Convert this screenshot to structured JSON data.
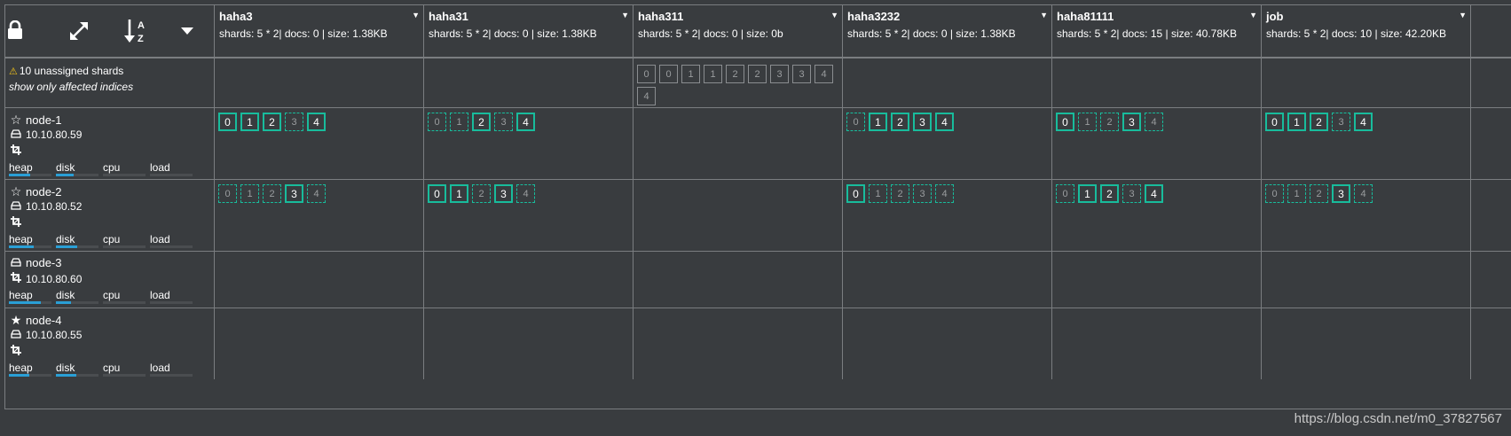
{
  "header": {
    "controls": [
      {
        "name": "lock-icon",
        "glyph": "lock"
      },
      {
        "name": "expand-icon",
        "glyph": "expand"
      },
      {
        "name": "sort-alpha-icon",
        "glyph": "sort"
      },
      {
        "name": "caret-down-icon",
        "glyph": "caret"
      }
    ]
  },
  "indices": [
    {
      "name": "haha3",
      "stats": "shards: 5 * 2| docs: 0 | size: 1.38KB"
    },
    {
      "name": "haha31",
      "stats": "shards: 5 * 2| docs: 0 | size: 1.38KB"
    },
    {
      "name": "haha311",
      "stats": "shards: 5 * 2| docs: 0 | size: 0b"
    },
    {
      "name": "haha3232",
      "stats": "shards: 5 * 2| docs: 0 | size: 1.38KB"
    },
    {
      "name": "haha81111",
      "stats": "shards: 5 * 2| docs: 15 | size: 40.78KB"
    },
    {
      "name": "job",
      "stats": "shards: 5 * 2| docs: 10 | size: 42.20KB"
    }
  ],
  "unassigned": {
    "message": "10 unassigned shards",
    "link": "show only affected indices",
    "shards": [
      [],
      [],
      [
        "0",
        "0",
        "1",
        "1",
        "2",
        "2",
        "3",
        "3",
        "4",
        "4"
      ],
      [],
      [],
      []
    ]
  },
  "nodes": [
    {
      "name": "node-1",
      "ip": "10.10.80.59",
      "role_icon": "star-outline-icon",
      "master": false,
      "show_name_icon": true,
      "metrics": [
        {
          "label": "heap",
          "level": 0.5
        },
        {
          "label": "disk",
          "level": 0.42
        },
        {
          "label": "cpu",
          "level": 0
        },
        {
          "label": "load",
          "level": 0
        }
      ],
      "shards": [
        [
          [
            "0",
            "p"
          ],
          [
            "1",
            "p"
          ],
          [
            "2",
            "p"
          ],
          [
            "3",
            "r"
          ],
          [
            "4",
            "p"
          ]
        ],
        [
          [
            "0",
            "r"
          ],
          [
            "1",
            "r"
          ],
          [
            "2",
            "p"
          ],
          [
            "3",
            "r"
          ],
          [
            "4",
            "p"
          ]
        ],
        [],
        [
          [
            "0",
            "r"
          ],
          [
            "1",
            "p"
          ],
          [
            "2",
            "p"
          ],
          [
            "3",
            "p"
          ],
          [
            "4",
            "p"
          ]
        ],
        [
          [
            "0",
            "p"
          ],
          [
            "1",
            "r"
          ],
          [
            "2",
            "r"
          ],
          [
            "3",
            "p"
          ],
          [
            "4",
            "r"
          ]
        ],
        [
          [
            "0",
            "p"
          ],
          [
            "1",
            "p"
          ],
          [
            "2",
            "p"
          ],
          [
            "3",
            "r"
          ],
          [
            "4",
            "p"
          ]
        ]
      ]
    },
    {
      "name": "node-2",
      "ip": "10.10.80.52",
      "role_icon": "star-outline-icon",
      "master": false,
      "show_name_icon": true,
      "metrics": [
        {
          "label": "heap",
          "level": 0.58
        },
        {
          "label": "disk",
          "level": 0.5
        },
        {
          "label": "cpu",
          "level": 0
        },
        {
          "label": "load",
          "level": 0
        }
      ],
      "shards": [
        [
          [
            "0",
            "r"
          ],
          [
            "1",
            "r"
          ],
          [
            "2",
            "r"
          ],
          [
            "3",
            "p"
          ],
          [
            "4",
            "r"
          ]
        ],
        [
          [
            "0",
            "p"
          ],
          [
            "1",
            "p"
          ],
          [
            "2",
            "r"
          ],
          [
            "3",
            "p"
          ],
          [
            "4",
            "r"
          ]
        ],
        [],
        [
          [
            "0",
            "p"
          ],
          [
            "1",
            "r"
          ],
          [
            "2",
            "r"
          ],
          [
            "3",
            "r"
          ],
          [
            "4",
            "r"
          ]
        ],
        [
          [
            "0",
            "r"
          ],
          [
            "1",
            "p"
          ],
          [
            "2",
            "p"
          ],
          [
            "3",
            "r"
          ],
          [
            "4",
            "p"
          ]
        ],
        [
          [
            "0",
            "r"
          ],
          [
            "1",
            "r"
          ],
          [
            "2",
            "r"
          ],
          [
            "3",
            "p"
          ],
          [
            "4",
            "r"
          ]
        ]
      ]
    },
    {
      "name": "node-3",
      "ip": "10.10.80.60",
      "role_icon": "drive-icon",
      "master": false,
      "show_name_icon": false,
      "metrics": [
        {
          "label": "heap",
          "level": 0.75
        },
        {
          "label": "disk",
          "level": 0.35
        },
        {
          "label": "cpu",
          "level": 0
        },
        {
          "label": "load",
          "level": 0
        }
      ],
      "shards": [
        [],
        [],
        [],
        [],
        [],
        []
      ]
    },
    {
      "name": "node-4",
      "ip": "10.10.80.55",
      "role_icon": "star-solid-icon",
      "master": true,
      "show_name_icon": true,
      "metrics": [
        {
          "label": "heap",
          "level": 0.48
        },
        {
          "label": "disk",
          "level": 0.48
        },
        {
          "label": "cpu",
          "level": 0
        },
        {
          "label": "load",
          "level": 0
        }
      ],
      "shards": [
        [],
        [],
        [],
        [],
        [],
        []
      ]
    }
  ],
  "watermark": "https://blog.csdn.net/m0_37827567",
  "colors": {
    "background": "#393c3f",
    "grid_line": "#7a7d80",
    "shard_border": "#18bc9c",
    "metric_fill": "#2a9fd6",
    "warning": "#f5c518"
  }
}
